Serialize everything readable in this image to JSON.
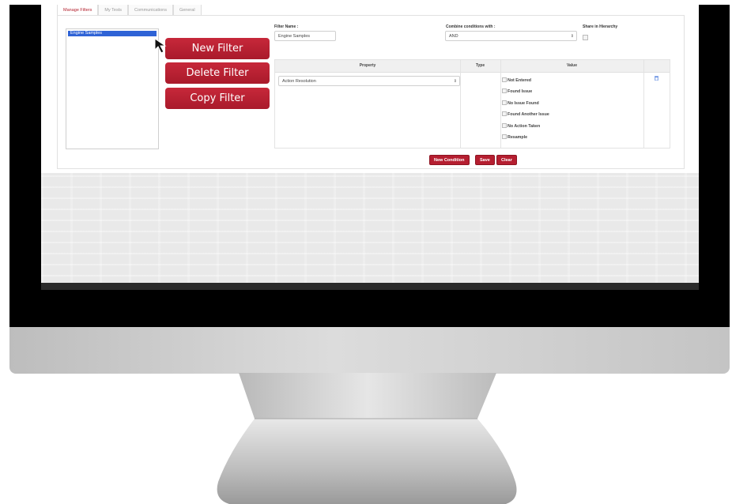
{
  "tabs": [
    {
      "label": "Manage Filters",
      "active": true
    },
    {
      "label": "My Tests",
      "active": false
    },
    {
      "label": "Communications",
      "active": false
    },
    {
      "label": "General",
      "active": false
    }
  ],
  "filter_list": {
    "items": [
      "Engine Samples"
    ],
    "selected_index": 0
  },
  "actions": {
    "new_filter": "New Filter",
    "delete_filter": "Delete Filter",
    "copy_filter": "Copy Filter"
  },
  "form": {
    "filter_name_label": "Filter Name :",
    "filter_name_value": "Engine Samples",
    "combine_label": "Combine conditions with :",
    "combine_value": "AND",
    "share_label": "Share in Hierarchy",
    "share_checked": false
  },
  "conditions_table": {
    "headers": {
      "property": "Property",
      "type": "Type",
      "value": "Value"
    },
    "rows": [
      {
        "property": "Action Resolution",
        "type": "",
        "value_options": [
          "Not Entered",
          "Found Issue",
          "No Issue Found",
          "Found Another Issue",
          "No Action Taken",
          "Resample"
        ]
      }
    ]
  },
  "bottom_buttons": {
    "new_condition": "New Condition",
    "save": "Save",
    "clear": "Clear"
  },
  "colors": {
    "accent_red": "#b3202e",
    "selection_blue": "#2f63d6"
  },
  "icons": {
    "select_arrow": "updown-arrows-icon",
    "delete_row": "trash-icon",
    "pointer": "mouse-cursor-icon"
  }
}
